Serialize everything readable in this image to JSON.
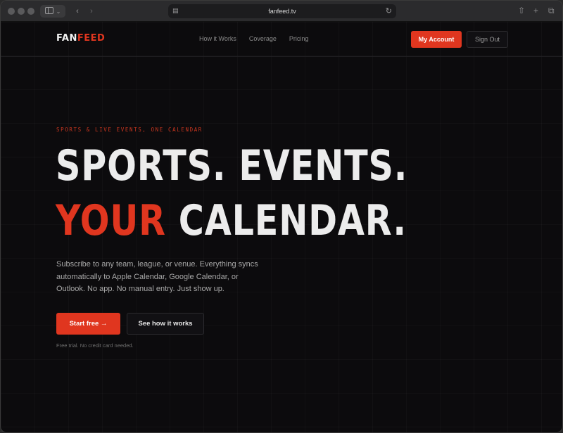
{
  "browser": {
    "url": "fanfeed.tv",
    "icons": {
      "sidebar": "sidebar-icon",
      "back": "chevron-left-icon",
      "forward": "chevron-right-icon",
      "reader": "reader-icon",
      "reload": "reload-icon",
      "share": "share-icon",
      "new_tab": "plus-icon",
      "tabs": "tabs-overview-icon"
    }
  },
  "nav": {
    "logo_part1": "FAN",
    "logo_part2": "FEED",
    "links": [
      "How it Works",
      "Coverage",
      "Pricing"
    ],
    "account_button": "My Account",
    "signout_button": "Sign Out"
  },
  "hero": {
    "eyebrow": "SPORTS & LIVE EVENTS, ONE CALENDAR",
    "headline_line1": "SPORTS. EVENTS.",
    "headline_line2_accent": "YOUR",
    "headline_line2_rest": " CALENDAR.",
    "subtext": "Subscribe to any team, league, or venue. Everything syncs automatically to Apple Calendar, Google Calendar, or Outlook. No app. No manual entry. Just show up.",
    "primary_cta": "Start free →",
    "secondary_cta": "See how it works",
    "fineprint": "Free trial. No credit card needed."
  },
  "colors": {
    "accent": "#e0361f",
    "background": "#0c0b0d",
    "headline": "#ececec"
  }
}
